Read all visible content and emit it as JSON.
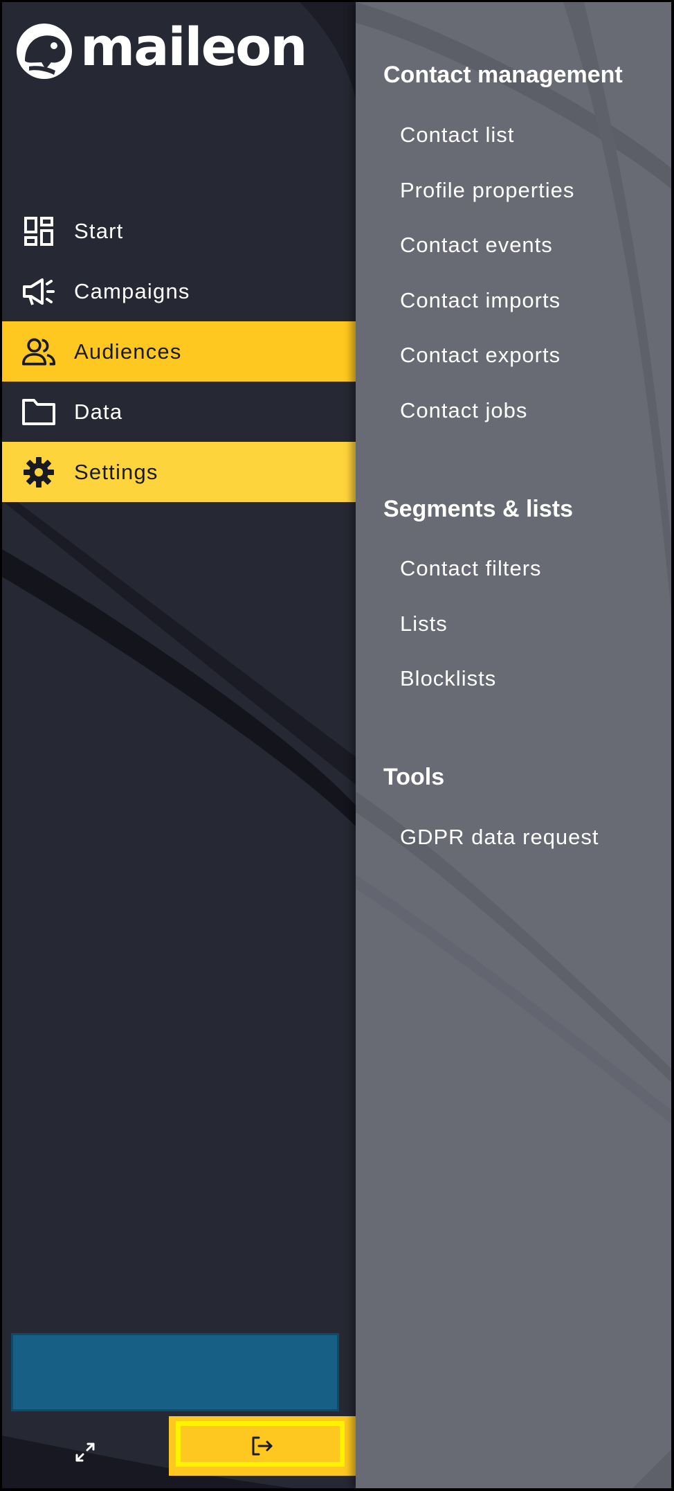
{
  "brand": {
    "name": "maileon"
  },
  "sidebar": {
    "items": [
      {
        "label": "Start",
        "icon": "dashboard-icon"
      },
      {
        "label": "Campaigns",
        "icon": "megaphone-icon"
      },
      {
        "label": "Audiences",
        "icon": "people-icon"
      },
      {
        "label": "Data",
        "icon": "folder-icon"
      },
      {
        "label": "Settings",
        "icon": "gear-icon"
      }
    ],
    "active_item": "Audiences",
    "hovered_item": "Settings"
  },
  "bottom_bar": {
    "collapse_icon": "collapse-arrows-icon",
    "logout_icon": "logout-icon"
  },
  "flyout": {
    "sections": [
      {
        "title": "Contact management",
        "links": [
          "Contact list",
          "Profile properties",
          "Contact events",
          "Contact imports",
          "Contact exports",
          "Contact jobs"
        ]
      },
      {
        "title": "Segments & lists",
        "links": [
          "Contact filters",
          "Lists",
          "Blocklists"
        ]
      },
      {
        "title": "Tools",
        "links": [
          "GDPR data request"
        ]
      }
    ]
  },
  "colors": {
    "sidebar_bg": "#262834",
    "flyout_bg": "#696b74",
    "accent": "#fec820",
    "hover": "#fed43d",
    "promo": "#175f85",
    "highlight": "#fff200"
  }
}
